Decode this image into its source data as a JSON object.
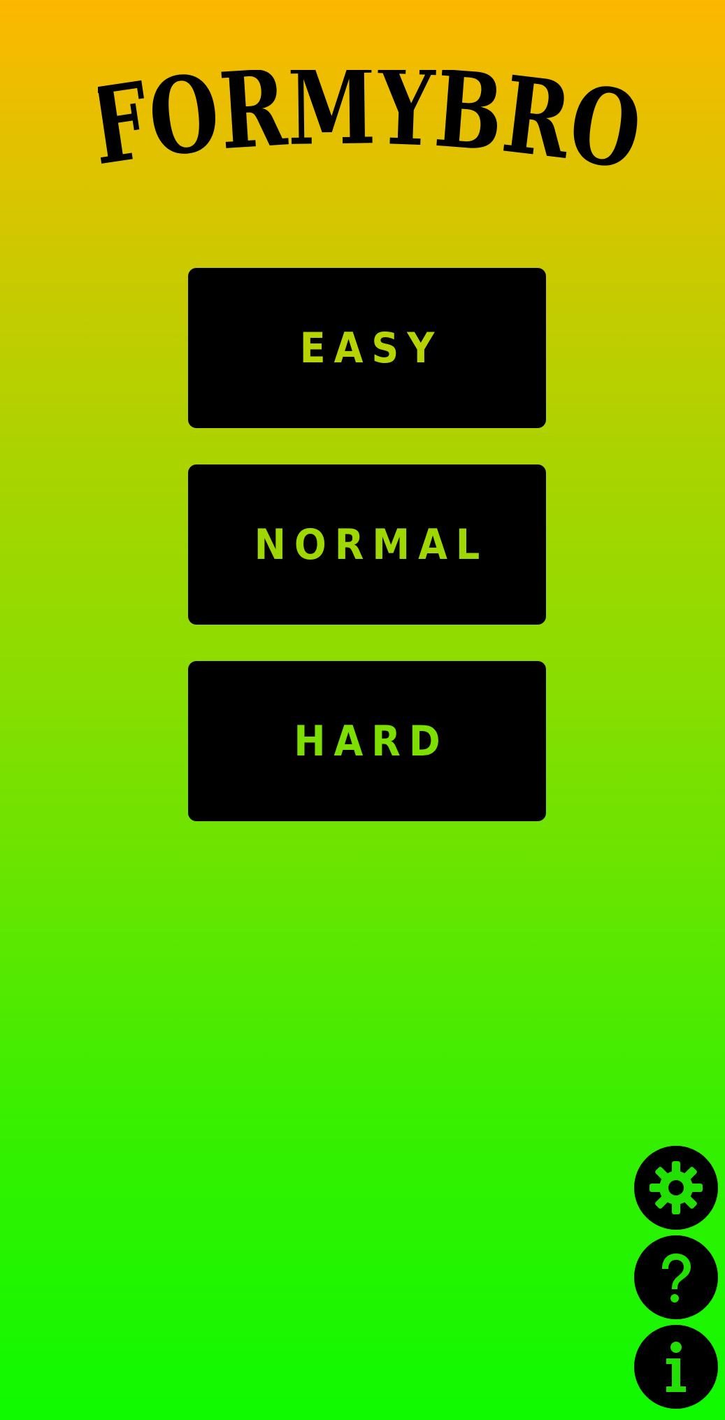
{
  "app": {
    "title": "FORMYBRO"
  },
  "menu": {
    "buttons": [
      {
        "label": "EASY",
        "color": "#B8D400"
      },
      {
        "label": "NORMAL",
        "color": "#9ED800"
      },
      {
        "label": "HARD",
        "color": "#7CDF00"
      }
    ]
  },
  "side_icons": [
    {
      "icon": "gear-icon"
    },
    {
      "icon": "question-icon"
    },
    {
      "icon": "info-icon"
    }
  ],
  "colors": {
    "background_top": "#FDB800",
    "background_bottom": "#0EFA00",
    "button_bg": "#000000",
    "icon_glyph": "#22E100"
  }
}
